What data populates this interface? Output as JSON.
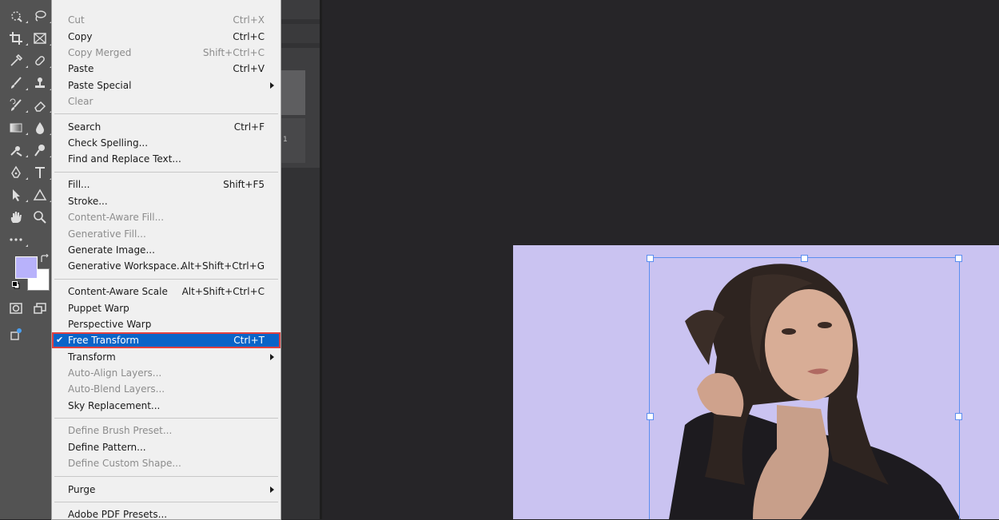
{
  "menu": {
    "items": [
      {
        "label": "Cut",
        "shortcut": "Ctrl+X",
        "disabled": true
      },
      {
        "label": "Copy",
        "shortcut": "Ctrl+C",
        "disabled": false
      },
      {
        "label": "Copy Merged",
        "shortcut": "Shift+Ctrl+C",
        "disabled": true
      },
      {
        "label": "Paste",
        "shortcut": "Ctrl+V",
        "disabled": false
      },
      {
        "label": "Paste Special",
        "shortcut": "",
        "disabled": false,
        "submenu": true
      },
      {
        "label": "Clear",
        "shortcut": "",
        "disabled": true
      },
      {
        "label": "Search",
        "shortcut": "Ctrl+F",
        "disabled": false
      },
      {
        "label": "Check Spelling...",
        "shortcut": "",
        "disabled": false
      },
      {
        "label": "Find and Replace Text...",
        "shortcut": "",
        "disabled": false
      },
      {
        "label": "Fill...",
        "shortcut": "Shift+F5",
        "disabled": false
      },
      {
        "label": "Stroke...",
        "shortcut": "",
        "disabled": false
      },
      {
        "label": "Content-Aware Fill...",
        "shortcut": "",
        "disabled": true
      },
      {
        "label": "Generative Fill...",
        "shortcut": "",
        "disabled": true
      },
      {
        "label": "Generate Image...",
        "shortcut": "",
        "disabled": false
      },
      {
        "label": "Generative Workspace...",
        "shortcut": "Alt+Shift+Ctrl+G",
        "disabled": false
      },
      {
        "label": "Content-Aware Scale",
        "shortcut": "Alt+Shift+Ctrl+C",
        "disabled": false
      },
      {
        "label": "Puppet Warp",
        "shortcut": "",
        "disabled": false
      },
      {
        "label": "Perspective Warp",
        "shortcut": "",
        "disabled": false
      },
      {
        "label": "Free Transform",
        "shortcut": "Ctrl+T",
        "disabled": false,
        "checked": true,
        "selected": true
      },
      {
        "label": "Transform",
        "shortcut": "",
        "disabled": false,
        "submenu": true
      },
      {
        "label": "Auto-Align Layers...",
        "shortcut": "",
        "disabled": true
      },
      {
        "label": "Auto-Blend Layers...",
        "shortcut": "",
        "disabled": true
      },
      {
        "label": "Sky Replacement...",
        "shortcut": "",
        "disabled": false
      },
      {
        "label": "Define Brush Preset...",
        "shortcut": "",
        "disabled": true
      },
      {
        "label": "Define Pattern...",
        "shortcut": "",
        "disabled": false
      },
      {
        "label": "Define Custom Shape...",
        "shortcut": "",
        "disabled": true
      },
      {
        "label": "Purge",
        "shortcut": "",
        "disabled": false,
        "submenu": true
      },
      {
        "label": "Adobe PDF Presets...",
        "shortcut": "",
        "disabled": false
      }
    ],
    "check_glyph": "✔"
  },
  "layers_panel": {
    "row_number": "1"
  },
  "toolbar": {
    "icons": [
      "quick-selection-icon",
      "lasso-icon",
      "crop-icon",
      "frame-icon",
      "eyedropper-icon",
      "healing-brush-icon",
      "brush-icon",
      "clone-stamp-icon",
      "history-brush-icon",
      "eraser-icon",
      "gradient-icon",
      "blur-icon",
      "dodge-icon",
      "burn-icon",
      "pen-icon",
      "type-icon",
      "path-selection-icon",
      "shape-icon",
      "hand-icon",
      "zoom-icon",
      "more-tools-icon"
    ],
    "foreground_color": "#b8b2fb",
    "background_color": "#ffffff"
  },
  "canvas": {
    "background_color": "#cac3f1",
    "transform_box_color": "#5b8ef0"
  },
  "colors": {
    "menu_bg": "#f0f0f0",
    "selection": "#0a64c8",
    "selection_outline": "#e04040"
  }
}
